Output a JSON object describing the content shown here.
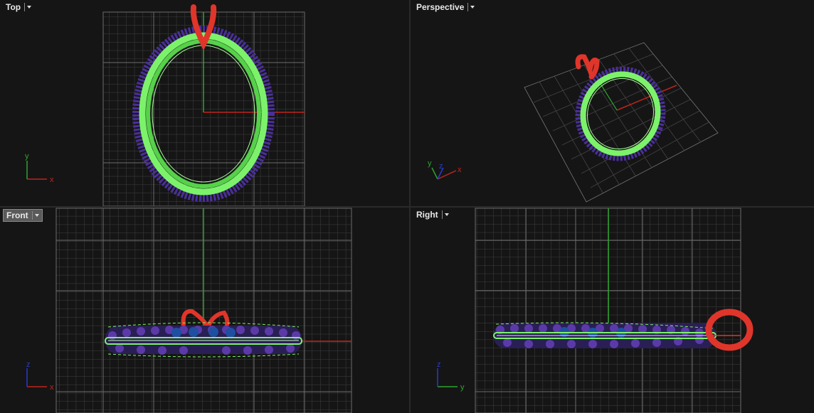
{
  "viewports": {
    "top": {
      "label": "Top",
      "axes": [
        "y",
        "x"
      ]
    },
    "perspective": {
      "label": "Perspective",
      "axes": [
        "y",
        "z",
        "x"
      ]
    },
    "front": {
      "label": "Front",
      "axes": [
        "z",
        "x"
      ]
    },
    "right": {
      "label": "Right",
      "axes": [
        "z",
        "y"
      ]
    }
  },
  "active_viewport": "Front",
  "colors": {
    "background": "#151515",
    "grid": "#3f3f3f",
    "grid_major": "#6a6a6a",
    "axis_x": "#c0241c",
    "axis_y": "#2fa32f",
    "axis_z": "#2a3ad0",
    "band": "#7cf26a",
    "gems": "#5a3aa0",
    "bail": "#e0352a"
  },
  "icons": [
    "dropdown-arrow-icon",
    "axis-gizmo-icon"
  ]
}
